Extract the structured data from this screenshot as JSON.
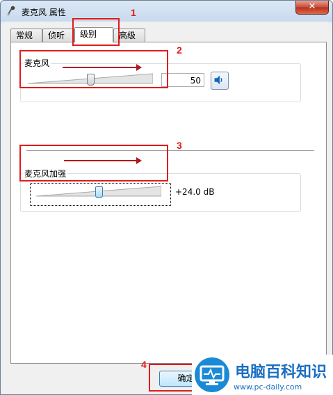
{
  "window": {
    "title": "麦克风 属性",
    "close_glyph": "✕"
  },
  "tabs": [
    {
      "label": "常规",
      "active": false
    },
    {
      "label": "侦听",
      "active": false
    },
    {
      "label": "级别",
      "active": true
    },
    {
      "label": "高级",
      "active": false
    }
  ],
  "microphone": {
    "label": "麦克风",
    "value": "50",
    "level_fraction": 0.5
  },
  "boost": {
    "label": "麦克风加强",
    "value": "+24.0 dB",
    "level_fraction": 0.5
  },
  "footer": {
    "ok_label": "确定"
  },
  "annotations": {
    "marker_1": "1",
    "marker_2": "2",
    "marker_3": "3",
    "marker_4": "4",
    "color": "#e01b1b"
  },
  "watermark": {
    "title": "电脑百科知识",
    "url": "www.pc-daily.com"
  },
  "colors": {
    "window_border": "#6d7f95",
    "close_button": "#c94a36",
    "panel_background": "#ffffff",
    "watermark_blue": "#1b6fc2"
  },
  "icons": {
    "title_icon": "microphone-icon",
    "speaker_icon": "speaker-icon",
    "watermark_icon": "monitor-icon"
  }
}
